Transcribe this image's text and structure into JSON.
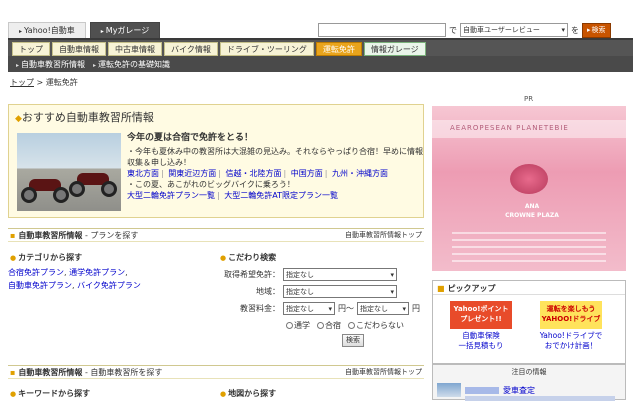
{
  "service_tabs": [
    {
      "label": "Yahoo!自動車",
      "active": false
    },
    {
      "label": "Myガレージ",
      "active": true
    }
  ],
  "search": {
    "value": "",
    "middle": "で",
    "scope_selected": "自動車ユーザーレビュー",
    "suffix": "を",
    "button": "検索"
  },
  "nav": {
    "tabs": [
      "トップ",
      "自動車情報",
      "中古車情報",
      "バイク情報",
      "ドライブ・ツーリング",
      "運転免許",
      "情報ガレージ"
    ],
    "active_index": 5
  },
  "sub_nav": [
    "自動車教習所情報",
    "運転免許の基礎知識"
  ],
  "breadcrumb": {
    "home": "トップ",
    "separator": " > ",
    "current": "運転免許"
  },
  "recommend": {
    "title": "おすすめ自動車教習所情報",
    "headline": "今年の夏は合宿で免許をとる！",
    "bullet1": "・今年も夏休み中の教習所は大混雑の見込み。それならやっぱり合宿！早めに情報収集＆申し込み！",
    "regions": [
      "東北方面",
      "関東近辺方面",
      "信越・北陸方面",
      "中国方面",
      "九州・沖縄方面"
    ],
    "bullet2": "・この夏、あこがれのビッグバイクに乗ろう！",
    "plans": [
      "大型二輪免許プラン一覧",
      "大型二輪免許AT限定プラン一覧"
    ]
  },
  "plan_section": {
    "title_bold": "自動車教習所情報",
    "title_rest": " - プランを探す",
    "right_link": "自動車教習所情報トップ",
    "category_title": "カテゴリから探す",
    "category_links": [
      "合宿免許プラン",
      "通学免許プラン",
      "自動車免許プラン",
      "バイク免許プラン"
    ],
    "filter_title": "こだわり検索",
    "license_label": "取得希望免許：",
    "license_value": "指定なし",
    "region_label": "地域：",
    "region_value": "指定なし",
    "fee_label": "教習料金：",
    "fee_from": "指定なし",
    "fee_mid": "円～",
    "fee_to": "指定なし",
    "fee_unit": "円",
    "radios": [
      "通学",
      "合宿",
      "こだわらない"
    ],
    "search_button": "検索"
  },
  "school_section": {
    "title_bold": "自動車教習所情報",
    "title_rest": " - 自動車教習所を探す",
    "right_link": "自動車教習所情報トップ",
    "keyword_title": "キーワードから探す",
    "map_title": "地図から探す"
  },
  "right": {
    "pr_label": "PR",
    "ad_text_top": "AEAROPESEAN PLANETEBIE",
    "ad_text_mid": "ANA\nCROWNE PLAZA",
    "pickup_title": "ピックアップ",
    "pickup_items": [
      {
        "image_text": "Yahoo!ポイント\nプレゼント!!",
        "caption": "自動車保険\n一括見積もり"
      },
      {
        "image_text": "運転を楽しもう\nYAHOO!ドライブ",
        "caption": "Yahoo!ドライブで\nおでかけ計画！"
      }
    ],
    "attention_title": "注目の情報",
    "attention_link": "愛車査定"
  },
  "colors": {
    "nav_bg": "#555555",
    "active_tab": "#e9a41c",
    "link": "#0000cc",
    "accent_icon": "#e0a000"
  }
}
